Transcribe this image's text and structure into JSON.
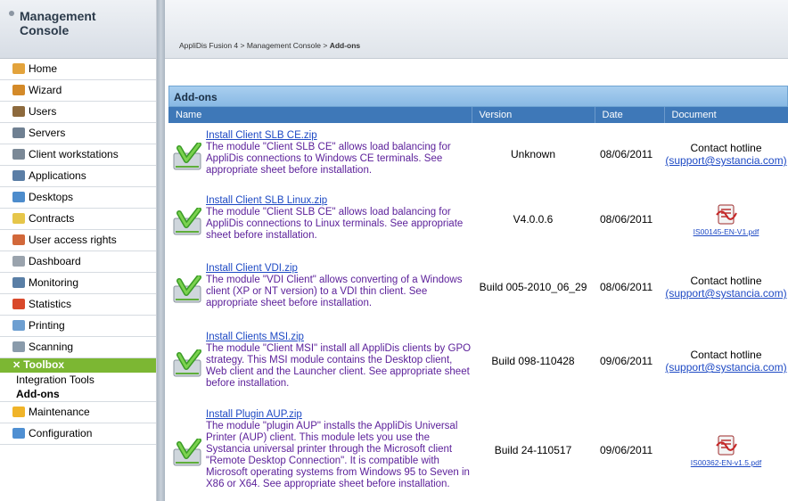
{
  "sidebar": {
    "title_line1": "Management",
    "title_line2": "Console",
    "items": [
      {
        "label": "Home",
        "icon": "home-icon",
        "color": "#e3a33c"
      },
      {
        "label": "Wizard",
        "icon": "wand-icon",
        "color": "#d48a29"
      },
      {
        "label": "Users",
        "icon": "users-icon",
        "color": "#8d6a3d"
      },
      {
        "label": "Servers",
        "icon": "servers-icon",
        "color": "#6f8092"
      },
      {
        "label": "Client workstations",
        "icon": "workstation-icon",
        "color": "#7a8896"
      },
      {
        "label": "Applications",
        "icon": "applications-icon",
        "color": "#5b7ea6"
      },
      {
        "label": "Desktops",
        "icon": "desktops-icon",
        "color": "#4d8ccc"
      },
      {
        "label": "Contracts",
        "icon": "contracts-icon",
        "color": "#e6c64a"
      },
      {
        "label": "User access rights",
        "icon": "user-access-icon",
        "color": "#d2683a"
      },
      {
        "label": "Dashboard",
        "icon": "dashboard-icon",
        "color": "#9aa3ad"
      },
      {
        "label": "Monitoring",
        "icon": "monitoring-icon",
        "color": "#5a7fa6"
      },
      {
        "label": "Statistics",
        "icon": "statistics-icon",
        "color": "#d9492b"
      },
      {
        "label": "Printing",
        "icon": "printer-icon",
        "color": "#6e9fd1"
      },
      {
        "label": "Scanning",
        "icon": "scanner-icon",
        "color": "#8a9bab"
      }
    ],
    "toolbox": {
      "label": "Toolbox",
      "icon": "tools-icon"
    },
    "sub_items": [
      {
        "label": "Integration Tools",
        "active": false
      },
      {
        "label": "Add-ons",
        "active": true
      }
    ],
    "bottom_items": [
      {
        "label": "Maintenance",
        "icon": "warning-icon",
        "color": "#f0b429"
      },
      {
        "label": "Configuration",
        "icon": "gear-icon",
        "color": "#4f8fd2"
      }
    ]
  },
  "breadcrumb": {
    "part1": "AppliDis Fusion 4",
    "sep": " > ",
    "part2": "Management Console",
    "part3": "Add-ons"
  },
  "panel": {
    "title": "Add-ons",
    "columns": {
      "name": "Name",
      "version": "Version",
      "date": "Date",
      "document": "Document"
    }
  },
  "addons": [
    {
      "link": "Install Client SLB CE.zip",
      "description": " The module \"Client SLB CE\" allows load balancing for AppliDis connections to Windows CE terminals. See appropriate sheet before installation.",
      "version": "Unknown",
      "date": "08/06/2011",
      "doc_type": "hotline",
      "hotline": "Contact hotline",
      "email": "(support@systancia.com)"
    },
    {
      "link": "Install Client SLB Linux.zip",
      "description": " The module \"Client SLB CE\" allows load balancing for AppliDis connections to Linux terminals. See appropriate sheet before installation.",
      "version": "V4.0.0.6",
      "date": "08/06/2011",
      "doc_type": "pdf",
      "pdf": "IS00145-EN-V1.pdf"
    },
    {
      "link": "Install Client VDI.zip",
      "description": " The module \"VDI Client\" allows converting of a Windows client (XP or NT version) to a VDI thin client. See appropriate sheet before installation.",
      "version": "Build 005-2010_06_29",
      "date": "08/06/2011",
      "doc_type": "hotline",
      "hotline": "Contact hotline",
      "email": "(support@systancia.com)"
    },
    {
      "link": "Install Clients MSI.zip",
      "description": " The module \"Client MSI\" install all AppliDis clients by GPO strategy. This MSI module contains the Desktop client, Web client and the Launcher client. See appropriate sheet before installation.",
      "version": "Build 098-110428",
      "date": "09/06/2011",
      "doc_type": "hotline",
      "hotline": "Contact hotline",
      "email": "(support@systancia.com)"
    },
    {
      "link": "Install Plugin AUP.zip",
      "description": " The module \"plugin AUP\" installs the AppliDis Universal Printer (AUP) client. This module lets you use the Systancia universal printer through the Microsoft client \"Remote Desktop Connection\". It is compatible with Microsoft operating systems from Windows 95 to Seven in X86 or X64. See appropriate sheet before installation.",
      "version": "Build 24-110517",
      "date": "09/06/2011",
      "doc_type": "pdf",
      "pdf": "IS00362-EN-v1.5.pdf"
    }
  ]
}
